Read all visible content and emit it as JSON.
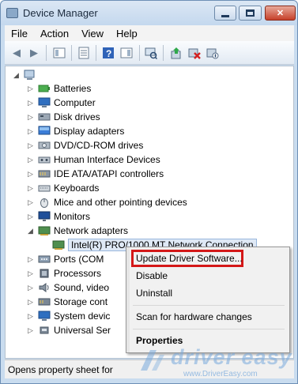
{
  "window": {
    "title": "Device Manager"
  },
  "menubar": {
    "items": [
      "File",
      "Action",
      "View",
      "Help"
    ]
  },
  "toolbar": {
    "buttons": [
      "back-icon",
      "forward-icon",
      "show-hide-icon",
      "properties-icon",
      "help-icon",
      "action-pane-icon",
      "scan-icon",
      "update-driver-icon",
      "uninstall-icon",
      "disable-icon"
    ]
  },
  "tree": {
    "categories": [
      {
        "label": "Batteries",
        "icon": "battery-icon"
      },
      {
        "label": "Computer",
        "icon": "computer-icon"
      },
      {
        "label": "Disk drives",
        "icon": "disk-drive-icon"
      },
      {
        "label": "Display adapters",
        "icon": "display-adapter-icon"
      },
      {
        "label": "DVD/CD-ROM drives",
        "icon": "dvd-drive-icon"
      },
      {
        "label": "Human Interface Devices",
        "icon": "hid-icon"
      },
      {
        "label": "IDE ATA/ATAPI controllers",
        "icon": "ide-controller-icon"
      },
      {
        "label": "Keyboards",
        "icon": "keyboard-icon"
      },
      {
        "label": "Mice and other pointing devices",
        "icon": "mouse-icon"
      },
      {
        "label": "Monitors",
        "icon": "monitor-icon"
      },
      {
        "label": "Network adapters",
        "icon": "network-adapter-icon"
      },
      {
        "label": "Intel(R) PRO/1000 MT Network Connection",
        "icon": "network-card-icon"
      },
      {
        "label": "Ports (COM",
        "icon": "port-icon"
      },
      {
        "label": "Processors",
        "icon": "processor-icon"
      },
      {
        "label": "Sound, video",
        "icon": "sound-icon"
      },
      {
        "label": "Storage cont",
        "icon": "storage-icon"
      },
      {
        "label": "System devic",
        "icon": "system-device-icon"
      },
      {
        "label": "Universal Ser",
        "icon": "usb-icon"
      }
    ]
  },
  "context_menu": {
    "items": [
      "Update Driver Software...",
      "Disable",
      "Uninstall",
      "Scan for hardware changes",
      "Properties"
    ]
  },
  "status": {
    "text": "Opens property sheet for t"
  },
  "watermark": {
    "brand": "driver easy",
    "url": "www.DriverEasy.com"
  }
}
